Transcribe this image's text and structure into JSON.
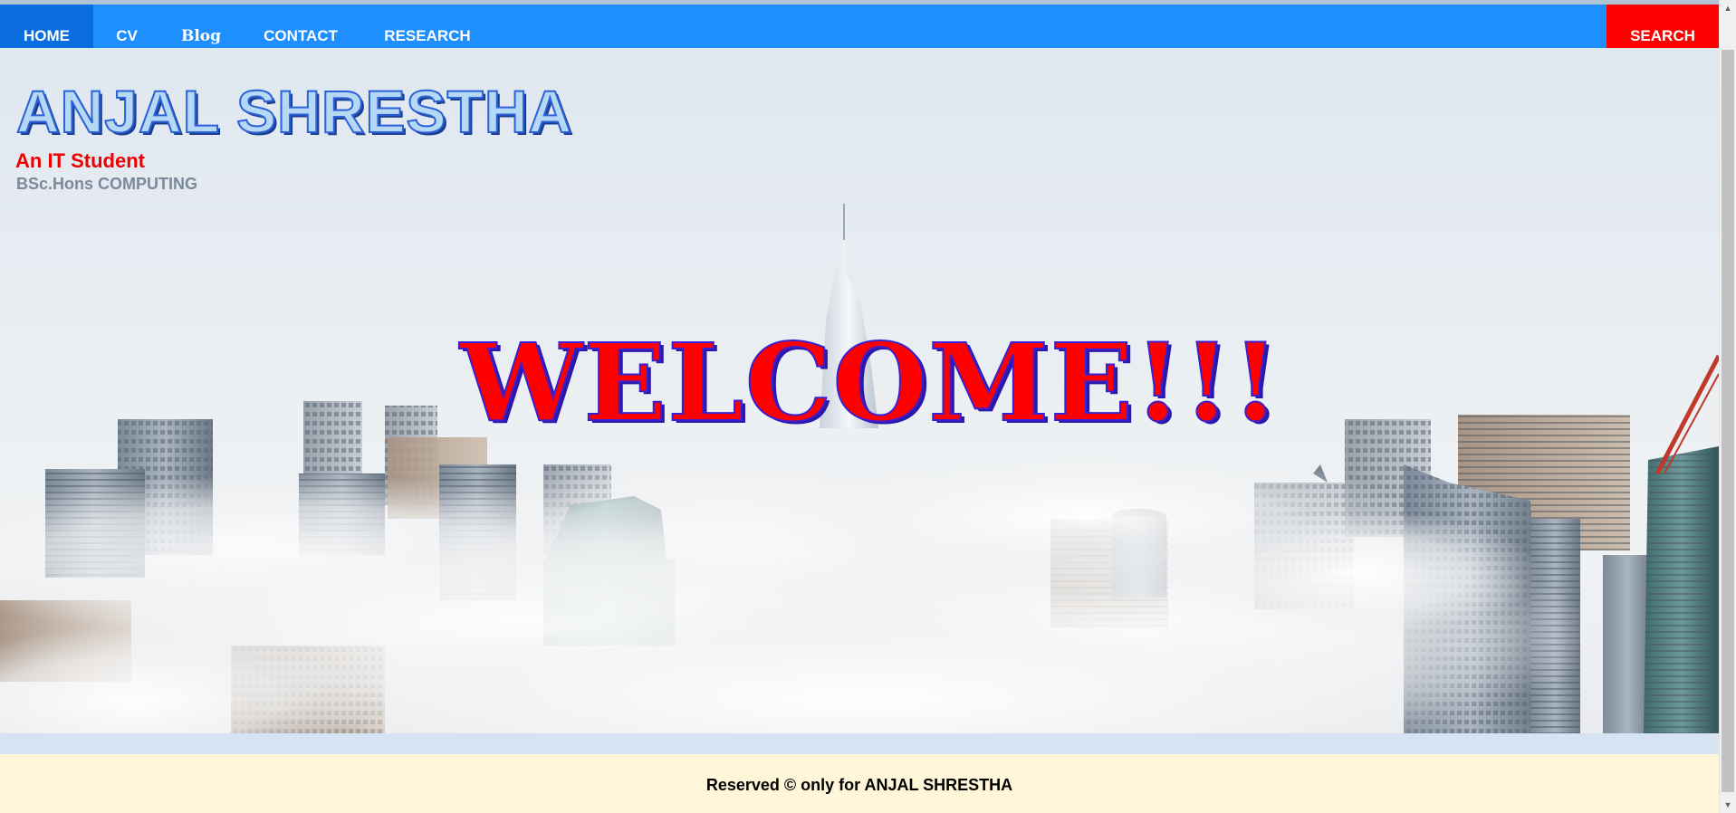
{
  "nav": {
    "home": "HOME",
    "cv": "CV",
    "blog": "Blog",
    "contact": "CONTACT",
    "research": "RESEARCH",
    "search": "SEARCH",
    "active": "HOME"
  },
  "hero": {
    "title": "ANJAL SHRESTHA",
    "subtitle": "An IT Student",
    "degree": "BSc.Hons COMPUTING",
    "welcome": "WELCOME!!!",
    "background": "city-skyscrapers-above-clouds-photo"
  },
  "footer": {
    "text": "Reserved © only for ANJAL SHRESTHA"
  },
  "colors": {
    "navbar": "#1e8fff",
    "nav_active": "#0a6ee0",
    "search_button": "#ff0000",
    "title_fill": "#b5d8f5",
    "title_outline": "#2d61d8",
    "subtitle": "#ee0000",
    "degree": "#7a8a9c",
    "welcome_fill": "#ff0000",
    "welcome_outline": "#3b1fd0",
    "footer_bg": "#fff5d9"
  },
  "icons": {
    "scroll_up": "chevron-up-icon",
    "scroll_down": "chevron-down-icon"
  }
}
